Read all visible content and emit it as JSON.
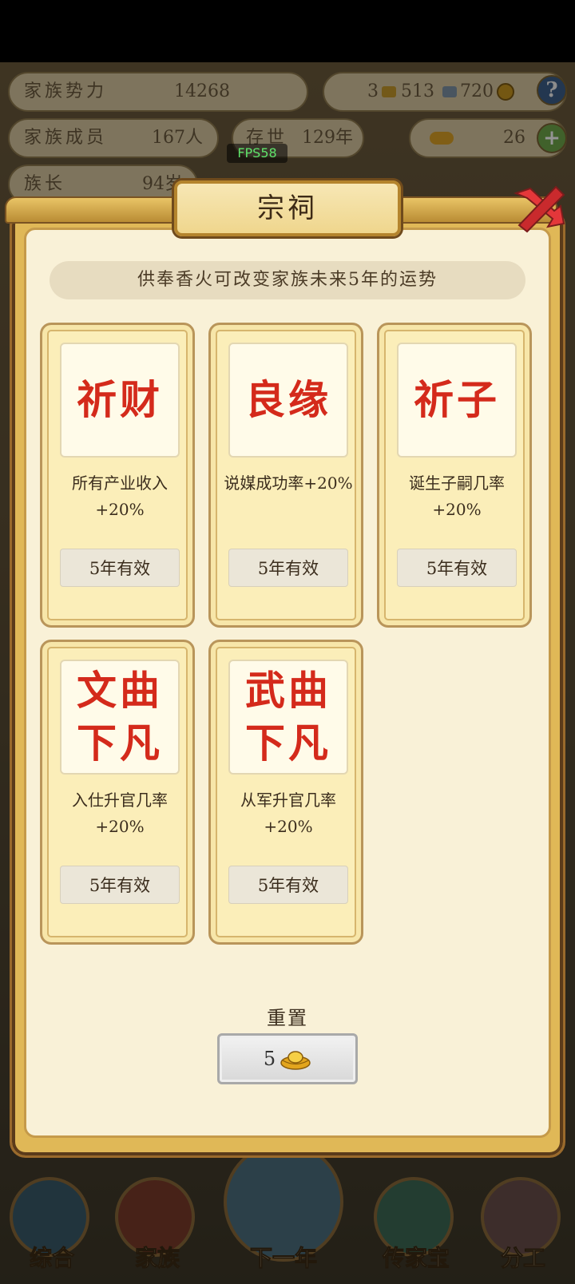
{
  "background": {
    "stats": {
      "power_label": "家族势力",
      "power_value": "14268",
      "members_label": "家族成员",
      "members_value": "167人",
      "years_label": "存世",
      "years_value": "129年",
      "age_label": "族长",
      "age_value": "94岁",
      "res1": "3",
      "res2": "513",
      "res3": "720",
      "gold_value": "26"
    },
    "nav": [
      "综合",
      "家族",
      "下一年",
      "传家宝",
      "分工"
    ]
  },
  "fps": "FPS58",
  "modal": {
    "title": "宗祠",
    "subtitle": "供奉香火可改变家族未来5年的运势",
    "cards": [
      {
        "name": "祈财",
        "desc": "所有产业收入+20%",
        "duration": "5年有效"
      },
      {
        "name": "良缘",
        "desc": "说媒成功率+20%",
        "duration": "5年有效"
      },
      {
        "name": "祈子",
        "desc": "诞生子嗣几率+20%",
        "duration": "5年有效"
      },
      {
        "name": "文曲下凡",
        "desc": "入仕升官几率+20%",
        "duration": "5年有效"
      },
      {
        "name": "武曲下凡",
        "desc": "从军升官几率+20%",
        "duration": "5年有效"
      }
    ],
    "reset_label": "重置",
    "reset_cost": "5"
  },
  "icons": {
    "close": "close-icon",
    "gold_ingot": "gold-ingot-icon",
    "help": "help-icon",
    "add": "add-icon"
  },
  "colors": {
    "card_title": "#d42a1b",
    "panel": "#f9f1d7",
    "frame_gold": "#e0b857"
  }
}
